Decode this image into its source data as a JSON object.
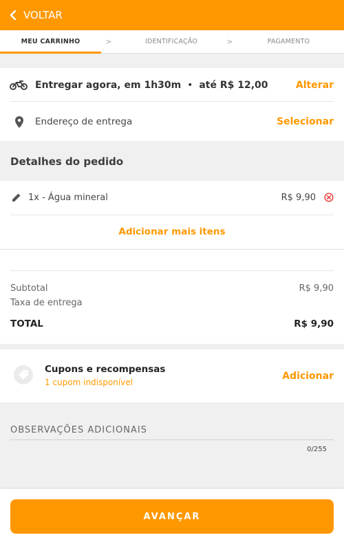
{
  "header": {
    "back_label": "VOLTAR"
  },
  "steps": [
    {
      "label": "MEU CARRINHO"
    },
    {
      "label": "IDENTIFICAÇÃO"
    },
    {
      "label": "PAGAMENTO"
    }
  ],
  "delivery": {
    "time_text": "Entregar agora, em 1h30m",
    "fee_text": "até R$ 12,00",
    "change_label": "Alterar",
    "address_text": "Endereço de entrega",
    "select_label": "Selecionar"
  },
  "order": {
    "title": "Detalhes do pedido",
    "items": [
      {
        "name": "1x - Água mineral",
        "price": "R$ 9,90"
      }
    ],
    "add_more_label": "Adicionar mais itens"
  },
  "totals": {
    "subtotal_label": "Subtotal",
    "subtotal_value": "R$ 9,90",
    "fee_label": "Taxa de entrega",
    "total_label": "TOTAL",
    "total_value": "R$ 9,90"
  },
  "coupons": {
    "title": "Cupons e recompensas",
    "subtitle": "1 cupom indisponível",
    "add_label": "Adicionar"
  },
  "notes": {
    "label": "OBSERVAÇÕES ADICIONAIS",
    "count": "0/255"
  },
  "footer": {
    "button_label": "AVANÇAR"
  },
  "colors": {
    "accent": "#ff9800",
    "remove": "#e53935"
  }
}
